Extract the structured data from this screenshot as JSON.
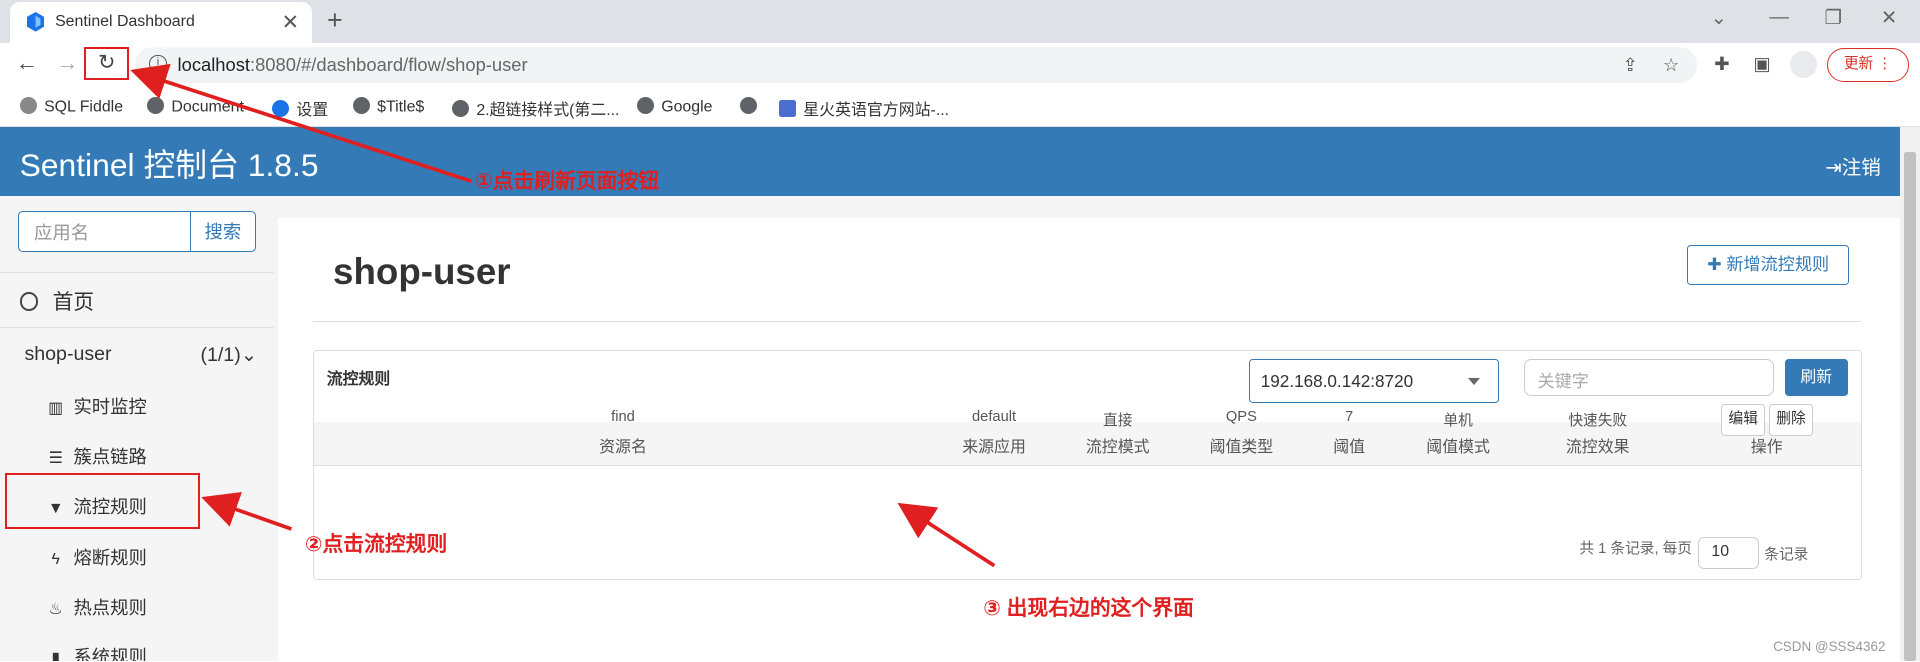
{
  "browser": {
    "tab_title": "Sentinel Dashboard",
    "url_host": "localhost",
    "url_rest": ":8080/#/dashboard/flow/shop-user",
    "update_label": "更新",
    "bookmarks": [
      "SQL Fiddle",
      "Document",
      "设置",
      "$Title$",
      "2.超链接样式(第二...",
      "Google",
      "",
      "星火英语官方网站-..."
    ]
  },
  "app": {
    "brand": "Sentinel 控制台 1.8.5",
    "logout": "注销"
  },
  "sidebar": {
    "search_placeholder": "应用名",
    "search_button": "搜索",
    "home": "首页",
    "app_name": "shop-user",
    "app_count": "(1/1)",
    "menu": [
      "实时监控",
      "簇点链路",
      "流控规则",
      "熔断规则",
      "热点规则",
      "系统规则"
    ]
  },
  "main": {
    "page_title": "shop-user",
    "add_button": "新增流控规则",
    "panel_title": "流控规则",
    "machine": "192.168.0.142:8720",
    "keyword_placeholder": "关键字",
    "refresh": "刷新",
    "columns": [
      "资源名",
      "来源应用",
      "流控模式",
      "阈值类型",
      "阈值",
      "阈值模式",
      "流控效果",
      "操作"
    ],
    "rows": [
      {
        "resource": "find",
        "origin": "default",
        "mode": "直接",
        "grade": "QPS",
        "count": "7",
        "cluster": "单机",
        "effect": "快速失败",
        "edit": "编辑",
        "delete": "删除"
      }
    ],
    "pager_text": "共 1 条记录, 每页",
    "page_size": "10",
    "pager_tail": "条记录"
  },
  "annotations": {
    "a1": "①点击刷新页面按钮",
    "a2": "②点击流控规则",
    "a3": "③ 出现右边的这个界面"
  },
  "watermark": "CSDN @SSS4362",
  "colors": {
    "primary": "#337ab7",
    "annotation": "#e02020"
  }
}
